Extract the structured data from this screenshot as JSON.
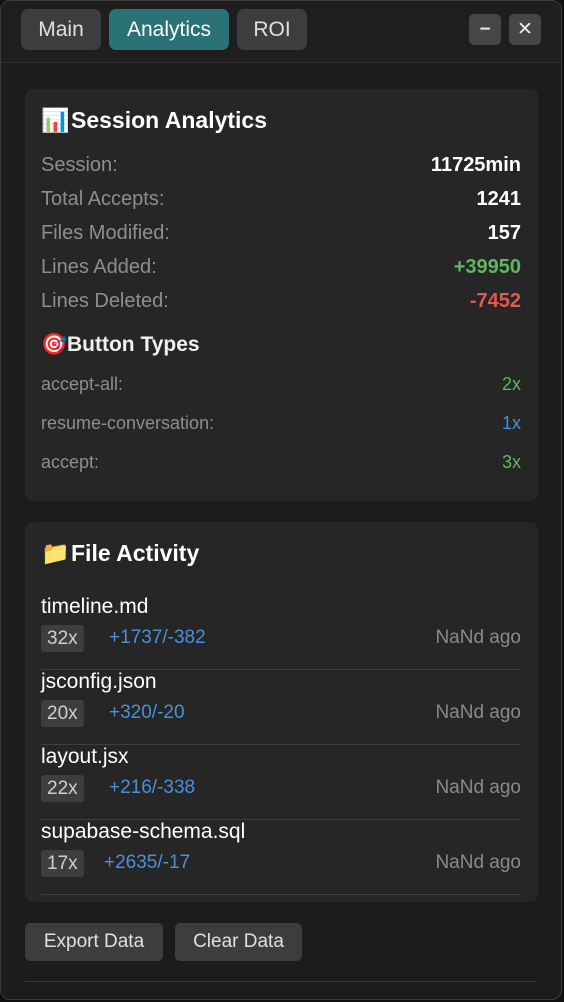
{
  "tabs": [
    {
      "label": "Main",
      "active": false
    },
    {
      "label": "Analytics",
      "active": true
    },
    {
      "label": "ROI",
      "active": false
    }
  ],
  "window_controls": {
    "minimize": "−",
    "close": "✕"
  },
  "session": {
    "icon": "📊",
    "title": "Session Analytics",
    "stats": [
      {
        "label": "Session:",
        "value": "11725min"
      },
      {
        "label": "Total Accepts:",
        "value": "1241"
      },
      {
        "label": "Files Modified:",
        "value": "157"
      },
      {
        "label": "Lines Added:",
        "value": "+39950"
      },
      {
        "label": "Lines Deleted:",
        "value": "-7452"
      }
    ],
    "button_types": {
      "icon": "🎯",
      "title": "Button Types",
      "items": [
        {
          "label": "accept-all:",
          "value": "2x"
        },
        {
          "label": "resume-conversation:",
          "value": "1x"
        },
        {
          "label": "accept:",
          "value": "3x"
        }
      ]
    }
  },
  "file_activity": {
    "icon": "📁",
    "title": "File Activity",
    "files": [
      {
        "name": "timeline.md",
        "count": "32x",
        "diff": "+1737/-382",
        "time": "NaNd ago"
      },
      {
        "name": "jsconfig.json",
        "count": "20x",
        "diff": "+320/-20",
        "time": "NaNd ago"
      },
      {
        "name": "layout.jsx",
        "count": "22x",
        "diff": "+216/-338",
        "time": "NaNd ago"
      },
      {
        "name": "supabase-schema.sql",
        "count": "17x",
        "diff": "+2635/-17",
        "time": "NaNd ago"
      }
    ]
  },
  "actions": {
    "export": "Export Data",
    "clear": "Clear Data"
  },
  "colors": {
    "accent_tab": "#2a7276",
    "added": "#5fb85f",
    "deleted": "#e05a4f",
    "info": "#4a90d9"
  }
}
